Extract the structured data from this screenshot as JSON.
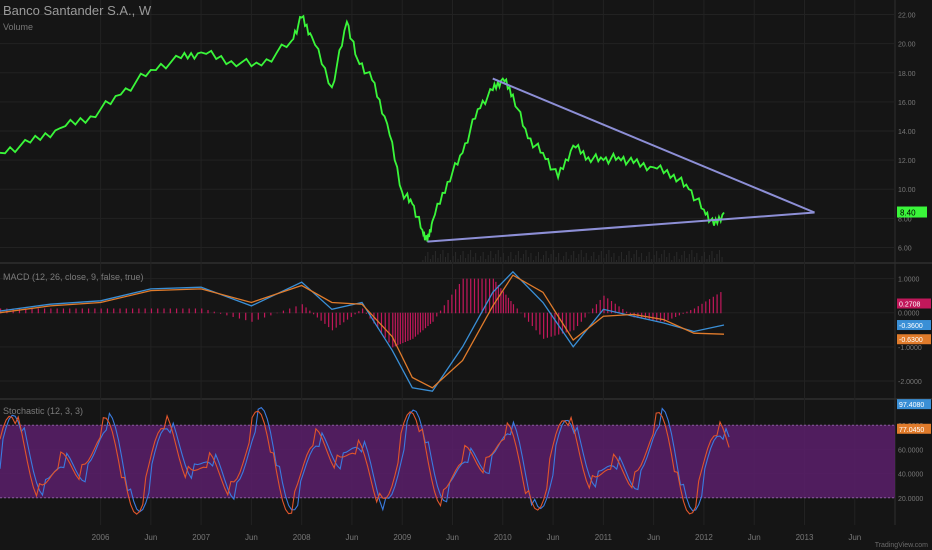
{
  "header": {
    "title": "Banco Santander S.A., W",
    "volume_label": "Volume"
  },
  "macd_label": "MACD (12, 26, close, 9, false, true)",
  "stoch_label": "Stochastic (12, 3, 3)",
  "footer": "TradingView.com",
  "colors": {
    "price": "#3af63a",
    "trendline": "#8d8fd6",
    "macd": "#3a8fd6",
    "signal": "#e07b2b",
    "hist": "#c2185b",
    "k": "#3a7be0",
    "d": "#e0552b",
    "band": "#5a1f6b"
  },
  "chart_data": [
    {
      "type": "line",
      "title": "Banco Santander S.A., W",
      "y_ticks": [
        "22.00",
        "20.00",
        "18.00",
        "16.00",
        "14.00",
        "12.00",
        "10.00",
        "8.00",
        "6.00"
      ],
      "ylim": [
        5,
        23
      ],
      "x_labels": [
        "2006",
        "Jun",
        "2007",
        "Jun",
        "2008",
        "Jun",
        "2009",
        "Jun",
        "2010",
        "Jun",
        "2011",
        "Jun",
        "2012",
        "Jun",
        "2013",
        "Jun"
      ],
      "series": [
        {
          "x": [
            2005.0,
            2005.3,
            2005.6,
            2005.9,
            2006.2,
            2006.5,
            2006.8,
            2007.0,
            2007.3,
            2007.6,
            2007.9,
            2008.0,
            2008.1,
            2008.3,
            2008.45,
            2008.55,
            2008.7,
            2008.85,
            2009.0,
            2009.1,
            2009.2,
            2009.25,
            2009.3,
            2009.45,
            2009.6,
            2009.75,
            2009.9,
            2010.0,
            2010.1,
            2010.25,
            2010.4,
            2010.55,
            2010.7,
            2010.85,
            2011.0,
            2011.15,
            2011.3,
            2011.5,
            2011.7,
            2011.85,
            2012.0,
            2012.1,
            2012.2
          ],
          "values": [
            12.5,
            13.2,
            14.2,
            15.0,
            16.5,
            18.2,
            19.0,
            19.4,
            18.8,
            18.5,
            20.2,
            21.8,
            20.5,
            17.0,
            21.5,
            19.0,
            17.5,
            14.5,
            9.8,
            9.0,
            7.2,
            6.4,
            7.8,
            10.5,
            12.5,
            15.5,
            16.8,
            17.6,
            16.5,
            13.5,
            12.5,
            10.8,
            13.0,
            12.2,
            12.0,
            12.2,
            11.8,
            11.5,
            11.0,
            10.0,
            8.6,
            7.5,
            8.4
          ]
        }
      ]
    },
    {
      "type": "line",
      "title": "MACD (12, 26, close, 9, false, true)",
      "y_ticks": [
        "1.0000",
        "0.0000",
        "-1.0000",
        "-2.0000"
      ],
      "ylim": [
        -2.5,
        1.4
      ],
      "last_values": [
        "0.2708",
        "-0.3600",
        "-0.6300"
      ],
      "series": [
        {
          "x": [
            2005.0,
            2005.5,
            2006.0,
            2006.5,
            2007.0,
            2007.5,
            2008.0,
            2008.3,
            2008.6,
            2008.9,
            2009.1,
            2009.3,
            2009.6,
            2009.9,
            2010.1,
            2010.4,
            2010.7,
            2011.0,
            2011.3,
            2011.6,
            2011.9,
            2012.2
          ],
          "values": [
            0.05,
            0.25,
            0.35,
            0.7,
            0.75,
            0.2,
            0.9,
            0.1,
            0.3,
            -1.1,
            -2.2,
            -2.3,
            -1.0,
            0.6,
            1.2,
            0.3,
            -1.0,
            0.1,
            -0.1,
            -0.3,
            -0.55,
            -0.36
          ]
        },
        {
          "x": [
            2005.0,
            2005.5,
            2006.0,
            2006.5,
            2007.0,
            2007.5,
            2008.0,
            2008.3,
            2008.6,
            2008.9,
            2009.1,
            2009.3,
            2009.6,
            2009.9,
            2010.1,
            2010.4,
            2010.7,
            2011.0,
            2011.3,
            2011.6,
            2011.9,
            2012.2
          ],
          "values": [
            0.0,
            0.2,
            0.3,
            0.65,
            0.7,
            0.3,
            0.8,
            0.3,
            0.25,
            -0.7,
            -1.9,
            -2.2,
            -1.4,
            0.2,
            1.1,
            0.6,
            -0.8,
            -0.1,
            -0.05,
            -0.2,
            -0.6,
            -0.63
          ]
        }
      ]
    },
    {
      "type": "line",
      "title": "Stochastic (12, 3, 3)",
      "y_ticks": [
        "80.0000",
        "60.0000",
        "40.0000",
        "20.0000"
      ],
      "ylim": [
        0,
        100
      ],
      "last_values": [
        "97.4080",
        "77.0450"
      ],
      "band": [
        20,
        80
      ]
    }
  ]
}
